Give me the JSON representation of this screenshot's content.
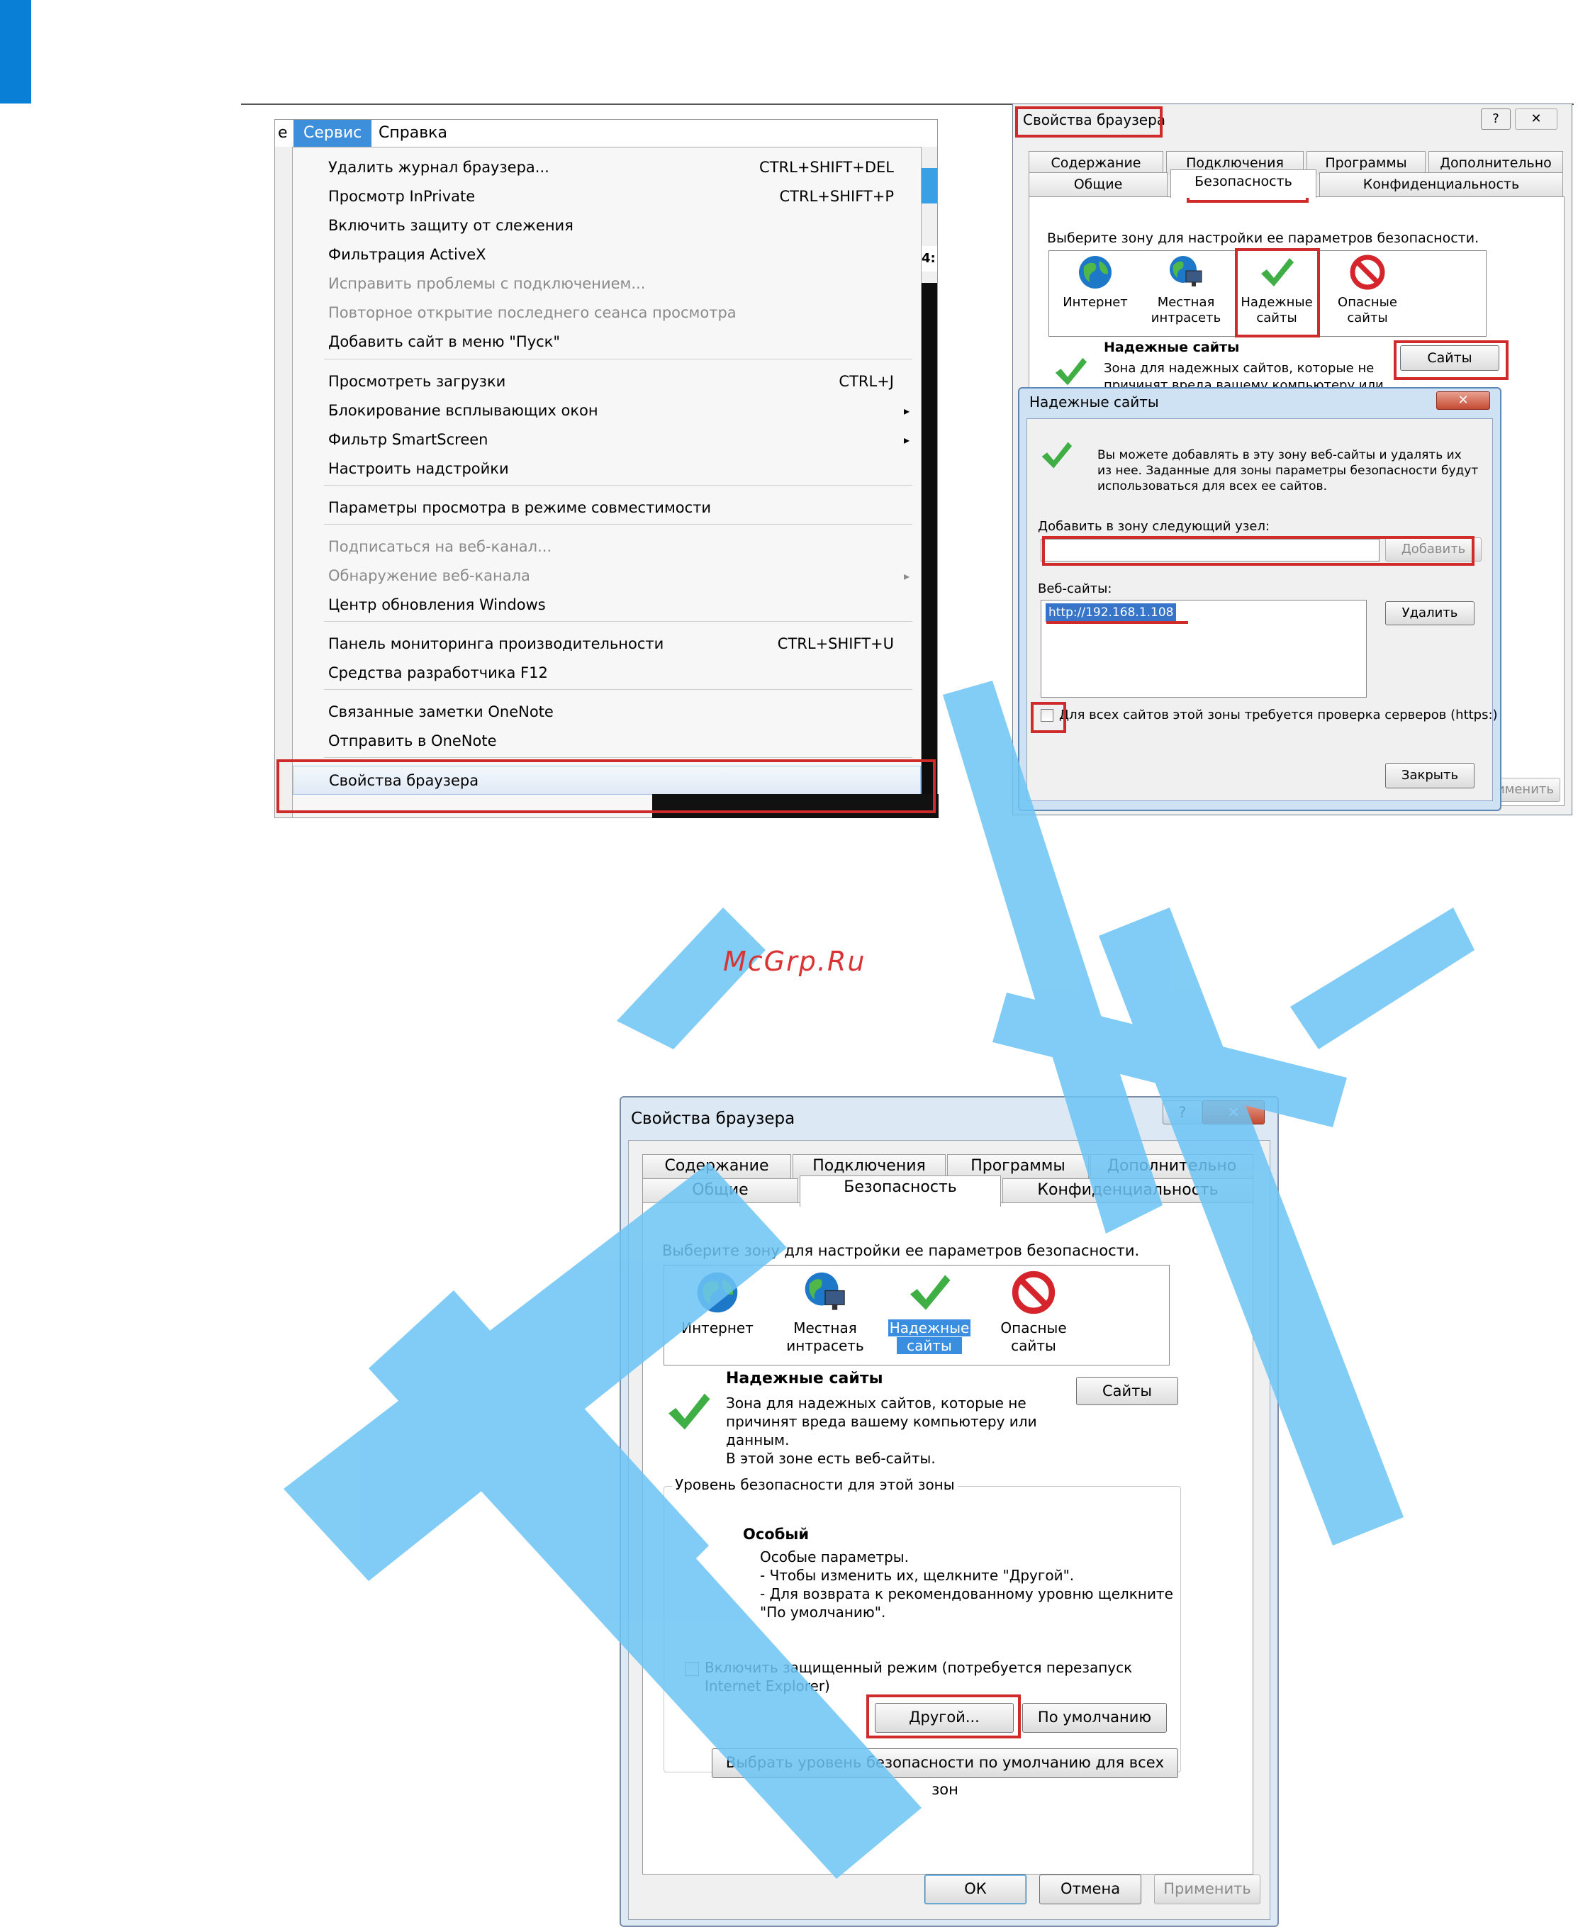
{
  "watermark": "McGrp.Ru",
  "menu": {
    "menubar": {
      "edge": "е",
      "service": "Сервис",
      "help": "Справка"
    },
    "items": [
      {
        "label": "Удалить журнал браузера...",
        "shortcut": "CTRL+SHIFT+DEL"
      },
      {
        "label": "Просмотр InPrivate",
        "shortcut": "CTRL+SHIFT+P"
      },
      {
        "label": "Включить защиту от слежения"
      },
      {
        "label": "Фильтрация ActiveX"
      },
      {
        "label": "Исправить проблемы с подключением..."
      },
      {
        "label": "Повторное открытие последнего сеанса просмотра"
      },
      {
        "label": "Добавить сайт в меню \"Пуск\""
      },
      {
        "label": "Просмотреть загрузки",
        "shortcut": "CTRL+J"
      },
      {
        "label": "Блокирование всплывающих окон",
        "arrow": "▸"
      },
      {
        "label": "Фильтр SmartScreen",
        "arrow": "▸"
      },
      {
        "label": "Настроить надстройки"
      },
      {
        "label": "Параметры просмотра в режиме совместимости"
      },
      {
        "label": "Подписаться на веб-канал..."
      },
      {
        "label": "Обнаружение веб-канала",
        "arrow": "▸"
      },
      {
        "label": "Центр обновления Windows"
      },
      {
        "label": "Панель мониторинга производительности",
        "shortcut": "CTRL+SHIFT+U"
      },
      {
        "label": "Средства разработчика F12"
      },
      {
        "label": "Связанные заметки OneNote"
      },
      {
        "label": "Отправить в OneNote"
      },
      {
        "label": "Свойства браузера"
      }
    ],
    "side_text": "4:"
  },
  "dialog_small": {
    "title": "Свойства браузера",
    "help_glyph": "?",
    "close_glyph": "✕",
    "tabs_row1": [
      "Содержание",
      "Подключения",
      "Программы",
      "Дополнительно"
    ],
    "tabs_row2": [
      "Общие",
      "Безопасность",
      "Конфиденциальность"
    ],
    "zone_prompt": "Выберите зону для настройки ее параметров безопасности.",
    "zones": [
      {
        "line1": "Интернет",
        "line2": ""
      },
      {
        "line1": "Местная",
        "line2": "интрасеть"
      },
      {
        "line1": "Надежные",
        "line2": "сайты"
      },
      {
        "line1": "Опасные",
        "line2": "сайты"
      }
    ],
    "zone_title": "Надежные сайты",
    "zone_desc1": "Зона для надежных сайтов, которые не",
    "zone_desc2": "причинят вреда вашему компьютеру или",
    "sites_btn": "Сайты",
    "apply_partial": "именить"
  },
  "dialog_sites": {
    "title": "Надежные сайты",
    "close_glyph": "✕",
    "info1": "Вы можете добавлять в эту зону  веб-сайты и удалять их",
    "info2": "из нее. Заданные для зоны параметры безопасности будут",
    "info3": "использоваться для всех ее сайтов.",
    "add_label": "Добавить в зону следующий узел:",
    "add_value": "",
    "add_btn": "Добавить",
    "sites_label": "Веб-сайты:",
    "sites": [
      "http://192.168.1.108"
    ],
    "remove_btn": "Удалить",
    "https_check": "Для всех сайтов этой зоны требуется проверка серверов (https:)",
    "close_btn": "Закрыть"
  },
  "dialog_big": {
    "title": "Свойства браузера",
    "help_glyph": "?",
    "close_glyph": "✕",
    "tabs_row1": [
      "Содержание",
      "Подключения",
      "Программы",
      "Дополнительно"
    ],
    "tabs_row2": [
      "Общие",
      "Безопасность",
      "Конфиденциальность"
    ],
    "zone_prompt": "Выберите зону для настройки ее параметров безопасности.",
    "zones": [
      {
        "line1": "Интернет",
        "line2": ""
      },
      {
        "line1": "Местная",
        "line2": "интрасеть"
      },
      {
        "line1": "Надежные",
        "line2": "сайты"
      },
      {
        "line1": "Опасные",
        "line2": "сайты"
      }
    ],
    "zone_title": "Надежные сайты",
    "zone_desc": [
      "Зона для надежных сайтов, которые не",
      "причинят вреда вашему компьютеру или",
      "данным.",
      "В этой зоне есть веб-сайты."
    ],
    "sites_btn": "Сайты",
    "level_group": "Уровень безопасности для этой зоны",
    "level_name": "Особый",
    "level_desc": [
      "Особые параметры.",
      "- Чтобы изменить их, щелкните \"Другой\".",
      "- Для возврата к рекомендованному уровню щелкните",
      "\"По умолчанию\"."
    ],
    "protected_mode1": "Включить защищенный режим (потребуется перезапуск",
    "protected_mode2": "Internet Explorer)",
    "custom_btn": "Другой...",
    "default_btn": "По умолчанию",
    "all_zones_btn": "Выбрать уровень безопасности по умолчанию для всех зон",
    "ok_btn": "ОК",
    "cancel_btn": "Отмена",
    "apply_btn": "Применить"
  },
  "colors": {
    "accent": "#3d8fdc",
    "highlight_red": "#d02b2b",
    "watermark_blue": "#6cc4f5"
  }
}
